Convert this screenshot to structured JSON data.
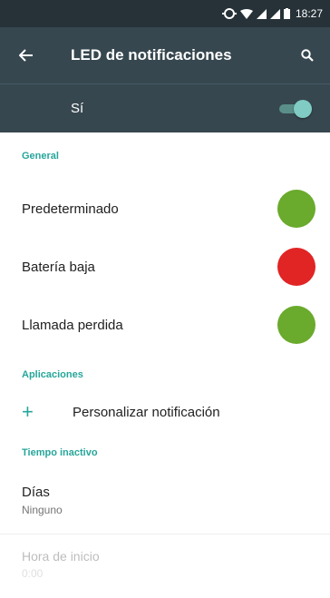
{
  "status_bar": {
    "time": "18:27"
  },
  "app_bar": {
    "title": "LED de notificaciones"
  },
  "master_switch": {
    "label": "Sí",
    "state": "on"
  },
  "sections": {
    "general": {
      "header": "General",
      "items": [
        {
          "label": "Predeterminado",
          "color": "#6aaa2c"
        },
        {
          "label": "Batería baja",
          "color": "#e12424"
        },
        {
          "label": "Llamada perdida",
          "color": "#6aaa2c"
        }
      ]
    },
    "apps": {
      "header": "Aplicaciones",
      "add_label": "Personalizar notificación"
    },
    "quiet": {
      "header": "Tiempo inactivo",
      "days": {
        "title": "Días",
        "value": "Ninguno"
      },
      "start": {
        "title": "Hora de inicio",
        "value": "0:00"
      }
    }
  }
}
